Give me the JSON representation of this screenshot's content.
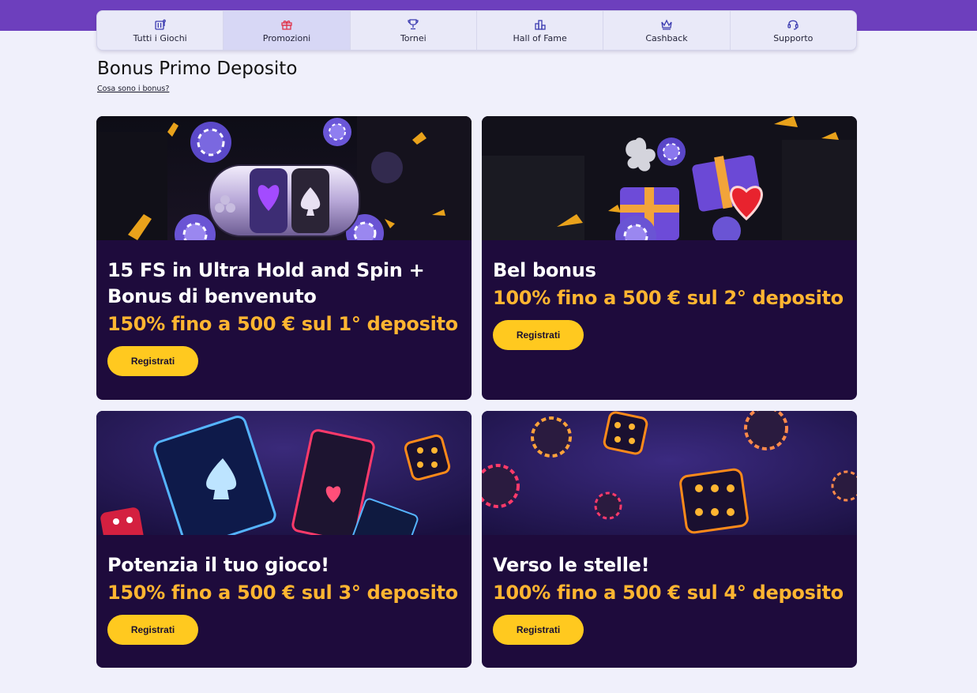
{
  "nav": {
    "items": [
      {
        "label": "Tutti i Giochi",
        "icon": "slot-machine-icon",
        "active": false
      },
      {
        "label": "Promozioni",
        "icon": "gift-icon",
        "active": true
      },
      {
        "label": "Tornei",
        "icon": "trophy-icon",
        "active": false
      },
      {
        "label": "Hall of Fame",
        "icon": "podium-icon",
        "active": false
      },
      {
        "label": "Cashback",
        "icon": "crown-icon",
        "active": false
      },
      {
        "label": "Supporto",
        "icon": "headset-icon",
        "active": false
      }
    ]
  },
  "page": {
    "title": "Bonus Primo Deposito",
    "help_link": "Cosa sono i bonus?"
  },
  "cards": [
    {
      "title": "15 FS in Ultra Hold and Spin + Bonus di benvenuto",
      "offer": "150% fino a 500 € sul 1° deposito",
      "button": "Registrati",
      "image": "slot-reels-banner"
    },
    {
      "title": "Bel bonus",
      "offer": "100% fino a 500 € sul 2° deposito",
      "button": "Registrati",
      "image": "gift-boxes-banner"
    },
    {
      "title": "Potenzia il tuo gioco!",
      "offer": "150% fino a 500 € sul 3° deposito",
      "button": "Registrati",
      "image": "playing-cards-banner"
    },
    {
      "title": "Verso le stelle!",
      "offer": "100% fino a 500 € sul 4° deposito",
      "button": "Registrati",
      "image": "dice-chips-banner"
    }
  ],
  "colors": {
    "header_band": "#6d3fbd",
    "card_background": "#1e0b3c",
    "offer_text": "#ffb531",
    "button": "#ffc91f",
    "page_background": "#f0f0fb"
  }
}
